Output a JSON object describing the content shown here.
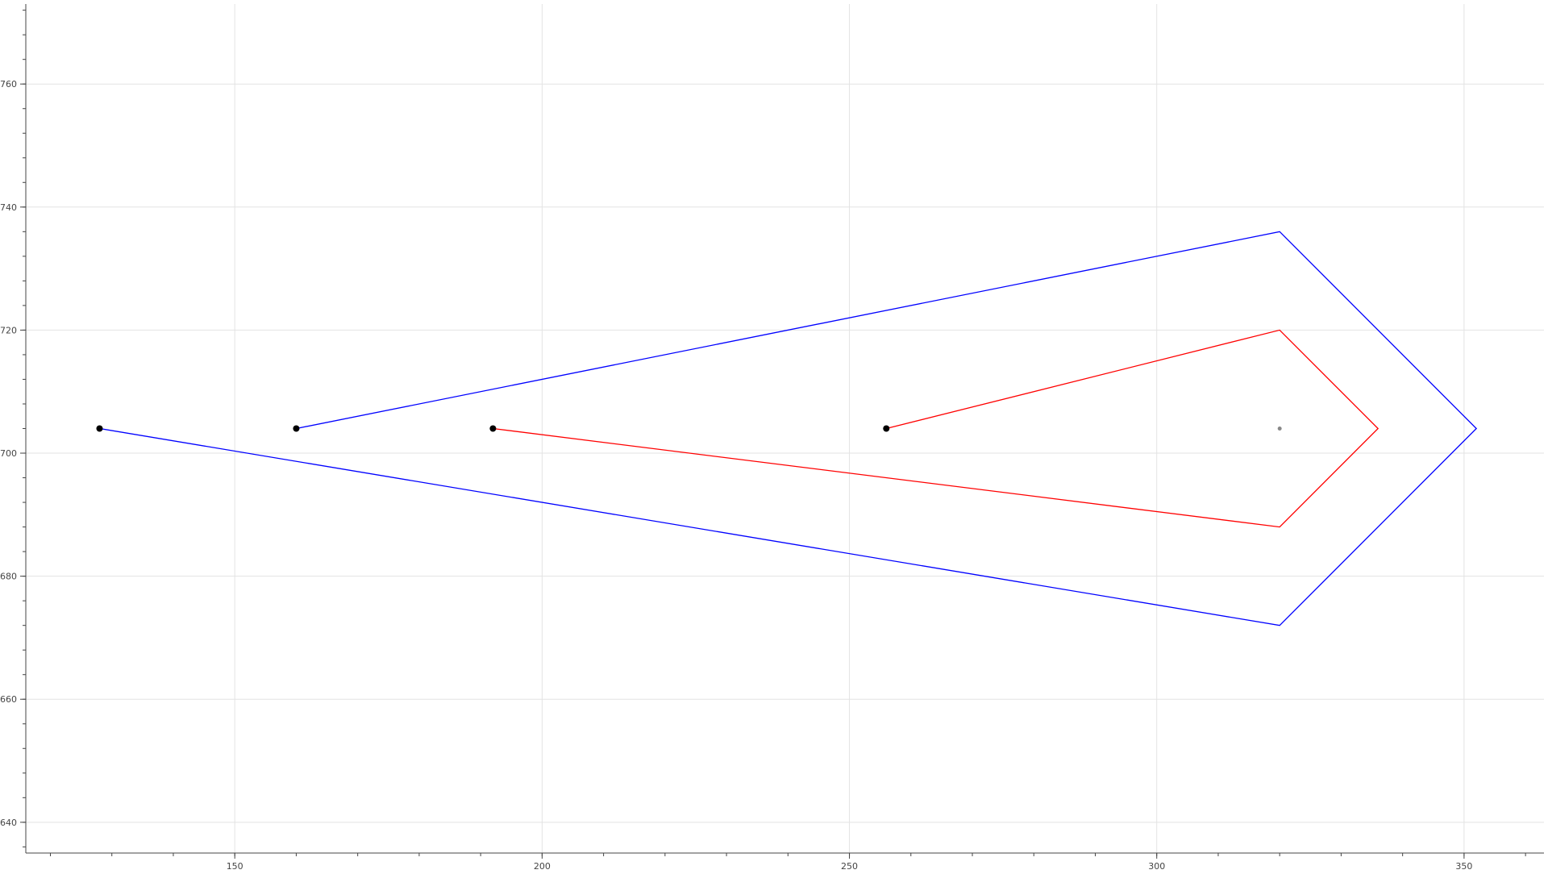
{
  "chart_data": {
    "type": "line",
    "title": "",
    "xlabel": "",
    "ylabel": "",
    "xlim": [
      116,
      363
    ],
    "ylim": [
      635,
      773
    ],
    "grid": true,
    "x_ticks": [
      150,
      200,
      250,
      300,
      350
    ],
    "y_ticks": [
      640,
      660,
      680,
      700,
      720,
      740,
      760
    ],
    "series": [
      {
        "color": "#0000ff",
        "points": [
          [
            160,
            704
          ],
          [
            320,
            736
          ],
          [
            352,
            704
          ],
          [
            320,
            672
          ],
          [
            128,
            704
          ]
        ]
      },
      {
        "color": "#ff0000",
        "points": [
          [
            256,
            704
          ],
          [
            320,
            720
          ],
          [
            336,
            704
          ],
          [
            320,
            688
          ],
          [
            192,
            704
          ]
        ]
      }
    ],
    "markers": [
      {
        "x": 128,
        "y": 704,
        "color": "#000000",
        "size": "large"
      },
      {
        "x": 160,
        "y": 704,
        "color": "#000000",
        "size": "large"
      },
      {
        "x": 192,
        "y": 704,
        "color": "#000000",
        "size": "large"
      },
      {
        "x": 256,
        "y": 704,
        "color": "#000000",
        "size": "large"
      },
      {
        "x": 320,
        "y": 704,
        "color": "#888888",
        "size": "small"
      }
    ]
  }
}
